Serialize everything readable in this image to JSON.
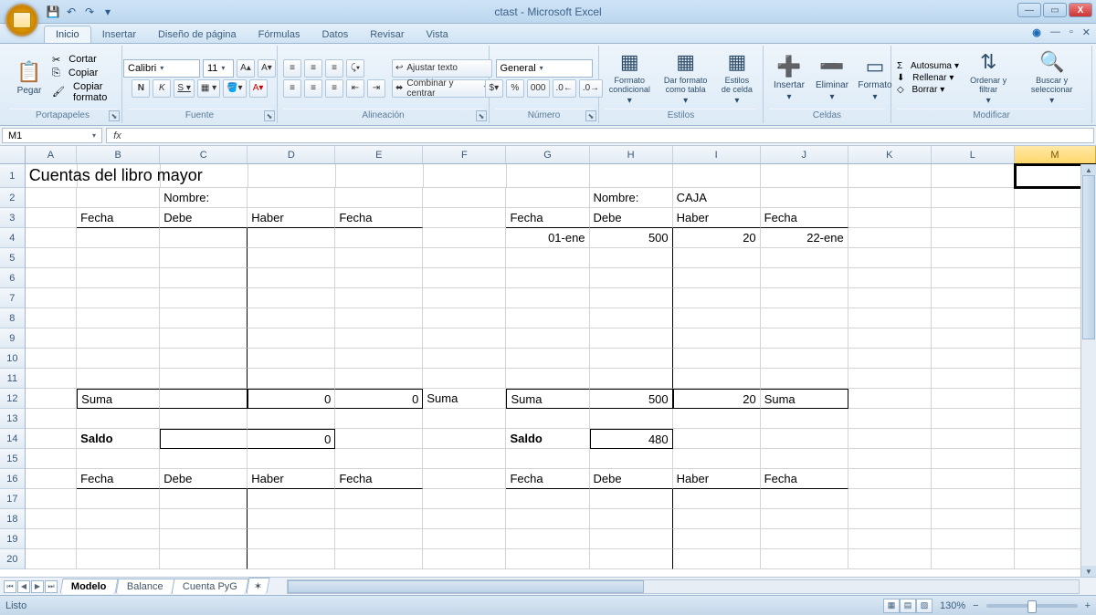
{
  "window": {
    "title": "ctast - Microsoft Excel"
  },
  "qat": {
    "save": "💾",
    "undo": "↶",
    "redo": "↷"
  },
  "tabs": {
    "items": [
      "Inicio",
      "Insertar",
      "Diseño de página",
      "Fórmulas",
      "Datos",
      "Revisar",
      "Vista"
    ],
    "active": 0
  },
  "ribbon": {
    "paste": "Pegar",
    "cut": "Cortar",
    "copy": "Copiar",
    "formatPainter": "Copiar formato",
    "clipboard": "Portapapeles",
    "font": "Calibri",
    "size": "11",
    "fontGroup": "Fuente",
    "wrap": "Ajustar texto",
    "merge": "Combinar y centrar",
    "alignment": "Alineación",
    "numberFormat": "General",
    "numberGroup": "Número",
    "condFmt": "Formato condicional",
    "tableFmt": "Dar formato como tabla",
    "cellStyles": "Estilos de celda",
    "stylesGroup": "Estilos",
    "insert": "Insertar",
    "delete": "Eliminar",
    "format": "Formato",
    "cellsGroup": "Celdas",
    "autosum": "Autosuma",
    "fill": "Rellenar",
    "clear": "Borrar",
    "sort": "Ordenar y filtrar",
    "find": "Buscar y seleccionar",
    "editGroup": "Modificar"
  },
  "namebox": "M1",
  "formula": "",
  "columns": [
    "A",
    "B",
    "C",
    "D",
    "E",
    "F",
    "G",
    "H",
    "I",
    "J",
    "K",
    "L",
    "M"
  ],
  "cells": {
    "A1": "Cuentas del libro mayor",
    "C2": "Nombre:",
    "H2": "Nombre:",
    "I2": "CAJA",
    "B3": "Fecha",
    "C3": "Debe",
    "D3": "Haber",
    "E3": "Fecha",
    "G3": "Fecha",
    "H3": "Debe",
    "I3": "Haber",
    "J3": "Fecha",
    "G4": "01-ene",
    "H4": "500",
    "I4": "20",
    "J4": "22-ene",
    "B12": "Suma",
    "D12": "0",
    "E12": "0",
    "F12": "Suma",
    "G12": "Suma",
    "H12": "500",
    "I12": "20",
    "J12": "Suma",
    "B14": "Saldo",
    "D14": "0",
    "G14": "Saldo",
    "H14": "480",
    "B16": "Fecha",
    "C16": "Debe",
    "D16": "Haber",
    "E16": "Fecha",
    "G16": "Fecha",
    "H16": "Debe",
    "I16": "Haber",
    "J16": "Fecha"
  },
  "selectedCell": "M1",
  "selectedCol": "M",
  "sheets": {
    "items": [
      "Modelo",
      "Balance",
      "Cuenta PyG"
    ],
    "active": 0
  },
  "status": {
    "ready": "Listo",
    "zoom": "130%"
  }
}
